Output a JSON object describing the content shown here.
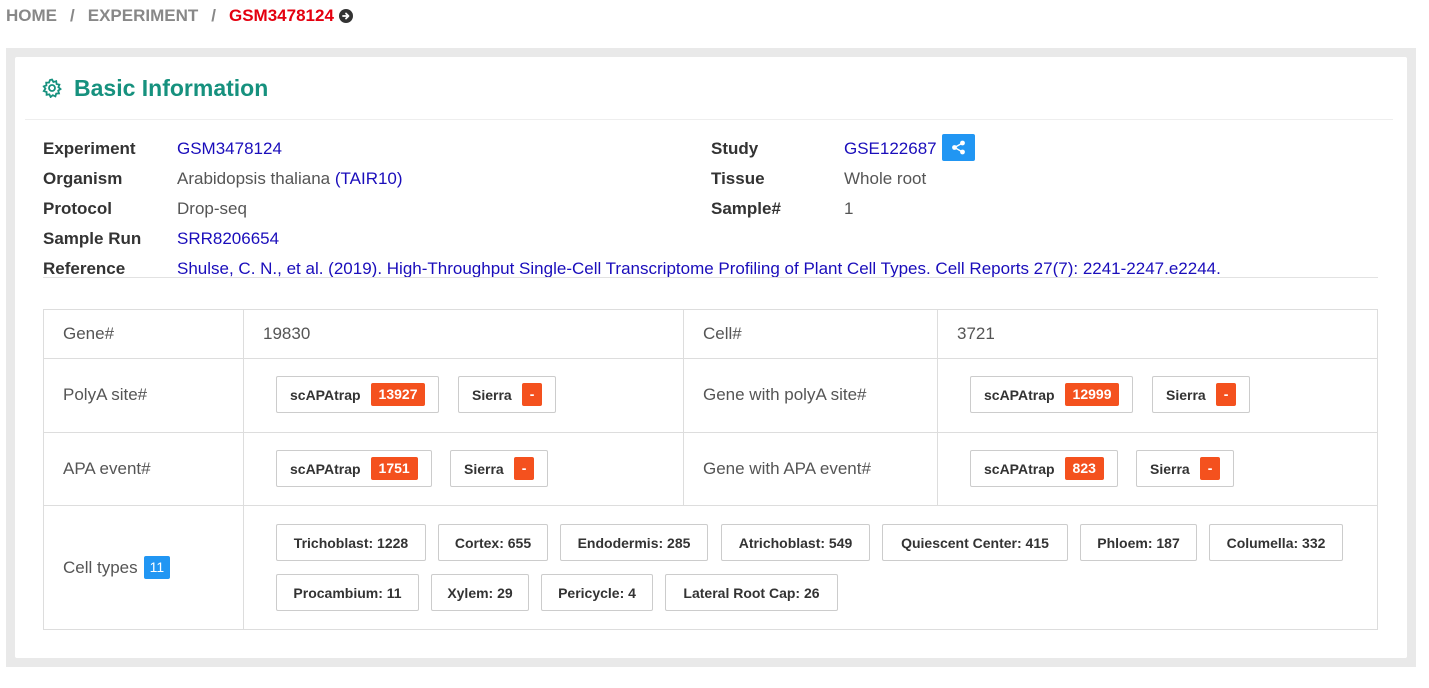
{
  "breadcrumb": {
    "home": "HOME",
    "experiment": "EXPERIMENT",
    "current": "GSM3478124",
    "separator": "/"
  },
  "card": {
    "title": "Basic Information",
    "title_icon": "gear-icon"
  },
  "info": {
    "experiment_label": "Experiment",
    "experiment_value": "GSM3478124",
    "organism_label": "Organism",
    "organism_value": "Arabidopsis thaliana",
    "organism_ref": "(TAIR10)",
    "protocol_label": "Protocol",
    "protocol_value": "Drop-seq",
    "sample_run_label": "Sample Run",
    "sample_run_value": "SRR8206654",
    "reference_label": "Reference",
    "reference_value": "Shulse, C. N., et al. (2019). High-Throughput Single-Cell Transcriptome Profiling of Plant Cell Types. Cell Reports 27(7): 2241-2247.e2244.",
    "study_label": "Study",
    "study_value": "GSE122687",
    "study_icon": "share-icon",
    "tissue_label": "Tissue",
    "tissue_value": "Whole root",
    "sample_num_label": "Sample#",
    "sample_num_value": "1"
  },
  "stats": {
    "gene_label": "Gene#",
    "gene_value": "19830",
    "cell_label": "Cell#",
    "cell_value": "3721",
    "polya_label": "PolyA site#",
    "polya_scapatrap_label": "scAPAtrap",
    "polya_scapatrap_count": "13927",
    "polya_sierra_label": "Sierra",
    "polya_sierra_count": "-",
    "gene_polya_label": "Gene with polyA site#",
    "gene_polya_scapatrap_label": "scAPAtrap",
    "gene_polya_scapatrap_count": "12999",
    "gene_polya_sierra_label": "Sierra",
    "gene_polya_sierra_count": "-",
    "apa_label": "APA event#",
    "apa_scapatrap_label": "scAPAtrap",
    "apa_scapatrap_count": "1751",
    "apa_sierra_label": "Sierra",
    "apa_sierra_count": "-",
    "gene_apa_label": "Gene with APA event#",
    "gene_apa_scapatrap_label": "scAPAtrap",
    "gene_apa_scapatrap_count": "823",
    "gene_apa_sierra_label": "Sierra",
    "gene_apa_sierra_count": "-",
    "cell_types_label": "Cell types",
    "cell_types_count": "11",
    "cell_types": [
      "Trichoblast: 1228",
      "Cortex: 655",
      "Endodermis: 285",
      "Atrichoblast: 549",
      "Quiescent Center: 415",
      "Phloem: 187",
      "Columella: 332",
      "Procambium: 11",
      "Xylem: 29",
      "Pericycle: 4",
      "Lateral Root Cap: 26"
    ]
  },
  "colors": {
    "accent_teal": "#16917e",
    "link_blue": "#1a0dbb",
    "breadcrumb_active": "#e4000f",
    "count_orange": "#f4511e",
    "badge_blue": "#2196f3"
  }
}
